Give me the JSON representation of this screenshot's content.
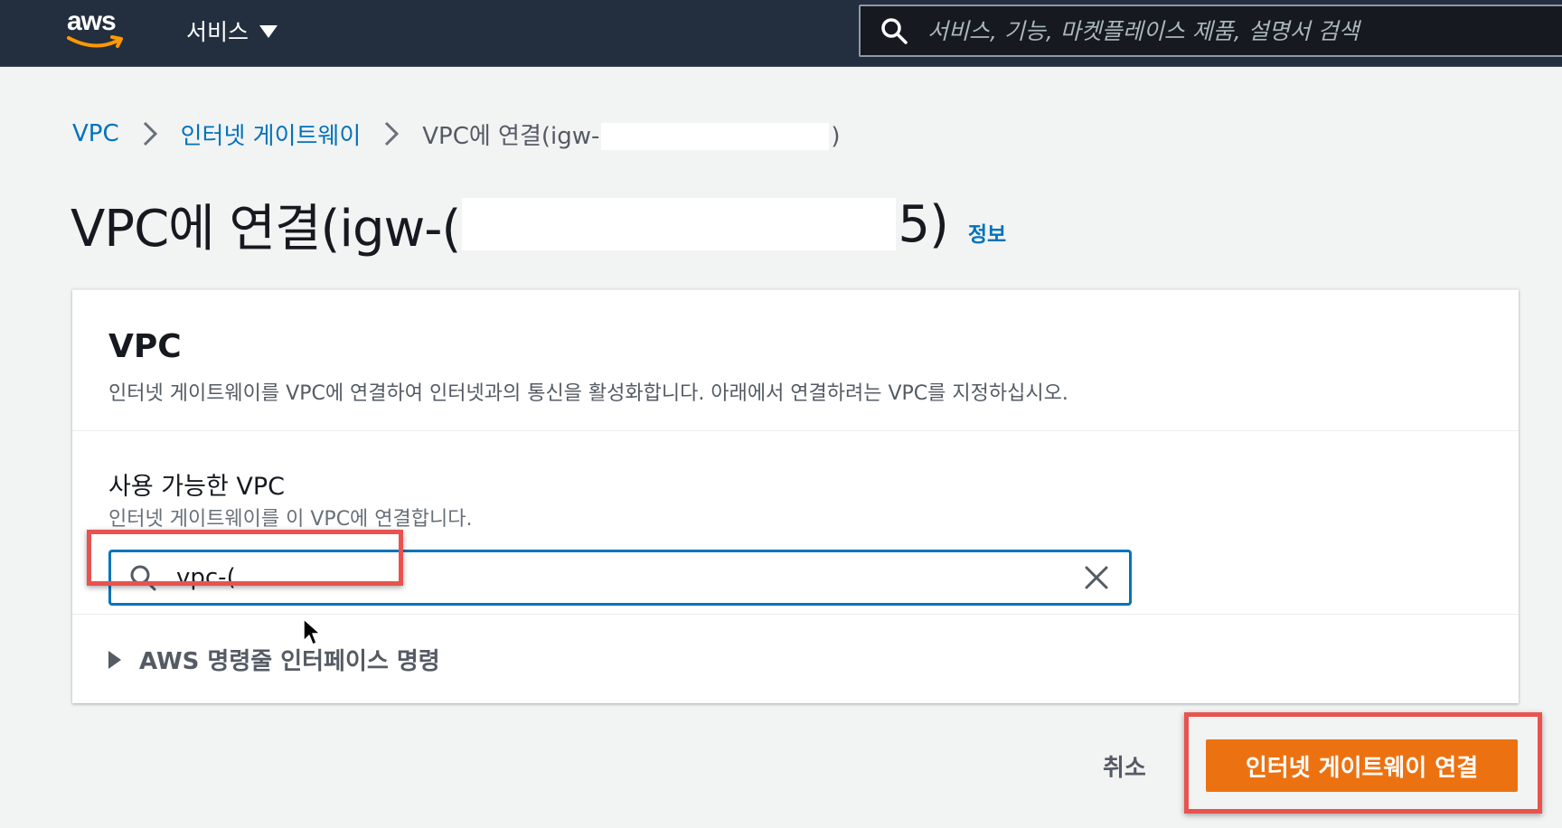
{
  "topnav": {
    "logo_text": "aws",
    "services_label": "서비스",
    "search_placeholder": "서비스, 기능, 마켓플레이스 제품, 설명서 검색"
  },
  "breadcrumb": {
    "items": [
      {
        "label": "VPC"
      },
      {
        "label": "인터넷 게이트웨이"
      }
    ],
    "current_prefix": "VPC에 연결(igw-",
    "current_suffix": ")"
  },
  "page": {
    "title_prefix": "VPC에 연결(igw-(",
    "title_suffix": "5)",
    "info_label": "정보"
  },
  "card": {
    "title": "VPC",
    "description": "인터넷 게이트웨이를 VPC에 연결하여 인터넷과의 통신을 활성화합니다. 아래에서 연결하려는 VPC를 지정하십시오."
  },
  "field": {
    "label": "사용 가능한 VPC",
    "description": "인터넷 게이트웨이를 이 VPC에 연결합니다.",
    "value": "vpc-("
  },
  "cli": {
    "label": "AWS 명령줄 인터페이스 명령"
  },
  "actions": {
    "cancel_label": "취소",
    "attach_label": "인터넷 게이트웨이 연결"
  },
  "colors": {
    "nav_bg": "#232f3e",
    "link": "#0073bb",
    "primary": "#ec7211",
    "annotation": "#e8534f"
  }
}
